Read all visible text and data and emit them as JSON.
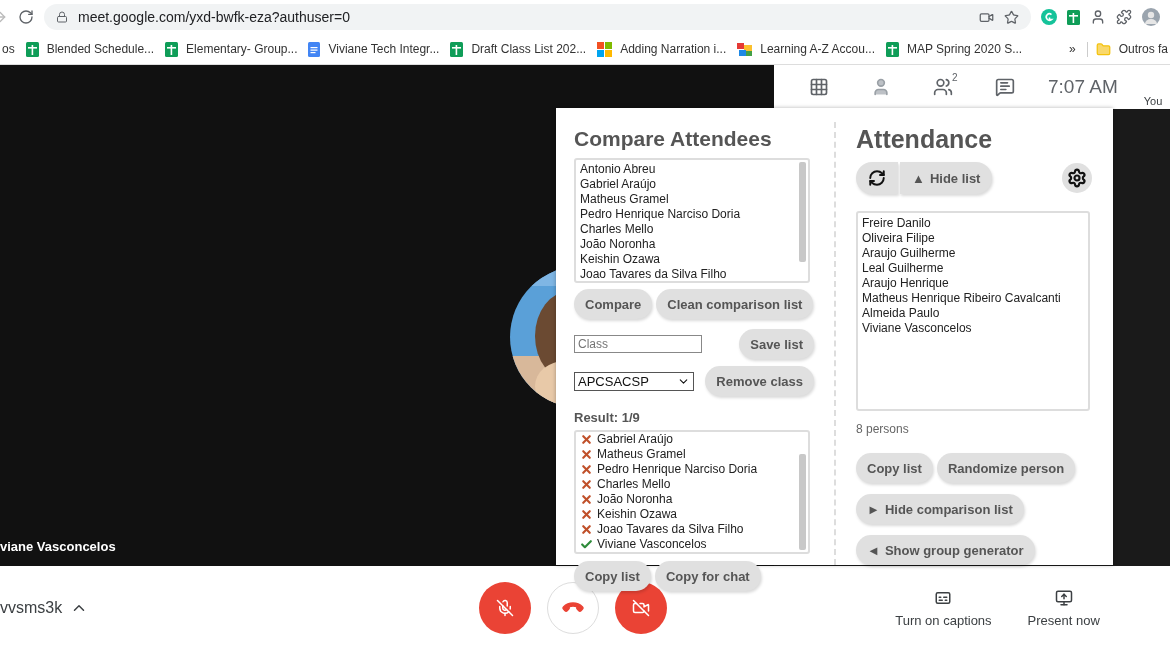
{
  "browser": {
    "url": "meet.google.com/yxd-bwfk-eza?authuser=0",
    "bookmarks": [
      {
        "kind": "text",
        "label": "os"
      },
      {
        "kind": "sheets",
        "label": "Blended Schedule..."
      },
      {
        "kind": "sheets",
        "label": "Elementary- Group..."
      },
      {
        "kind": "docs",
        "label": "Viviane Tech Integr..."
      },
      {
        "kind": "sheets",
        "label": "Draft Class List 202..."
      },
      {
        "kind": "microsoft",
        "label": "Adding Narration i..."
      },
      {
        "kind": "learning",
        "label": "Learning A-Z Accou..."
      },
      {
        "kind": "sheets",
        "label": "MAP Spring 2020 S..."
      }
    ],
    "more": "»",
    "folder": "Outros fa"
  },
  "meet": {
    "participants_badge": "2",
    "time": "7:07 AM",
    "self_label": "You",
    "speaker_name": "viane Vasconcelos",
    "meeting_code": "vvsms3k",
    "mic_muted": true,
    "camera_off": true,
    "captions": "Turn on captions",
    "present": "Present now"
  },
  "compare": {
    "title": "Compare Attendees",
    "names": [
      "Antonio Abreu",
      "Gabriel Araújo",
      "Matheus Gramel",
      "Pedro Henrique Narciso Doria",
      "Charles Mello",
      "João Noronha",
      "Keishin Ozawa",
      "Joao Tavares da Silva Filho"
    ],
    "buttons": [
      "Compare",
      "Clean comparison list"
    ],
    "class_field": {
      "placeholder": "Class"
    },
    "save": "Save list",
    "class_select": "APCSACSP",
    "remove": "Remove class",
    "result": "Result: 1/9",
    "results": [
      {
        "name": "Gabriel Araújo",
        "present": false
      },
      {
        "name": "Matheus Gramel",
        "present": false
      },
      {
        "name": "Pedro Henrique Narciso Doria",
        "present": false
      },
      {
        "name": "Charles Mello",
        "present": false
      },
      {
        "name": "João Noronha",
        "present": false
      },
      {
        "name": "Keishin Ozawa",
        "present": false
      },
      {
        "name": "Joao Tavares da Silva Filho",
        "present": false
      },
      {
        "name": "Viviane Vasconcelos",
        "present": true
      }
    ],
    "result_buttons": [
      "Copy list",
      "Copy for chat"
    ]
  },
  "attendance": {
    "title": "Attendance",
    "hide_list": {
      "mark": "▲",
      "label": "Hide list"
    },
    "names": [
      "Freire Danilo",
      "Oliveira Filipe",
      "Araujo Guilherme",
      "Leal Guilherme",
      "Araujo Henrique",
      "Matheus Henrique Ribeiro Cavalcanti",
      "Almeida Paulo",
      "Viviane Vasconcelos"
    ],
    "count": "8 persons",
    "buttons": [
      "Copy list",
      "Randomize person"
    ],
    "toggles": [
      {
        "mark": "►",
        "label": "Hide comparison list"
      },
      {
        "mark": "◄",
        "label": "Show group generator"
      }
    ]
  }
}
